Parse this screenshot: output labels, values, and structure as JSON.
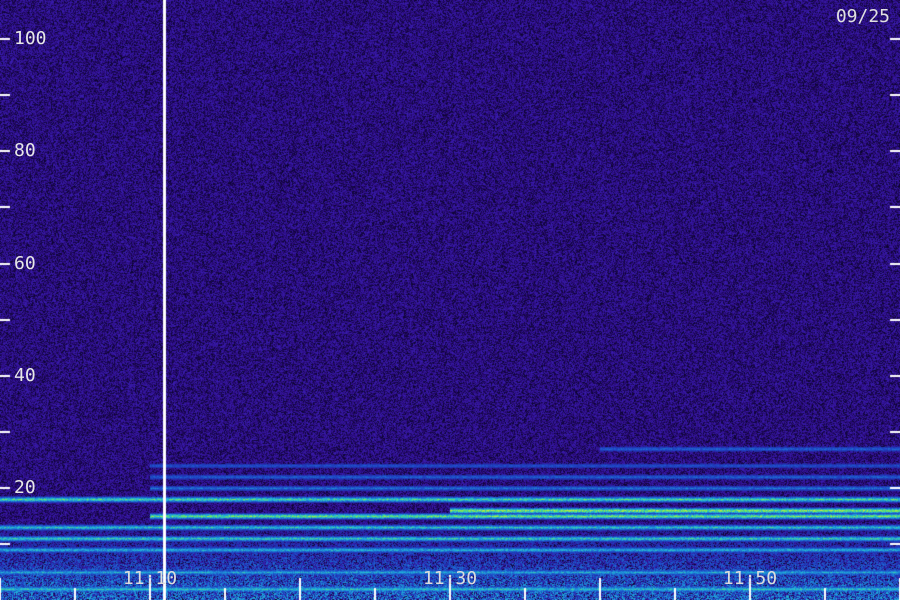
{
  "date_label": "09/25",
  "chart_data": {
    "type": "heatmap",
    "title": "",
    "xlabel": "",
    "ylabel": "",
    "y_ticks": [
      "100",
      "80",
      "60",
      "40",
      "20"
    ],
    "x_ticks": [
      "11:10",
      "11:30",
      "11:50"
    ],
    "ylim": [
      0,
      107
    ],
    "xlim": [
      "11:00",
      "12:00"
    ],
    "marker_time": "11:11",
    "colors": {
      "background": "#2a0a7a",
      "noise_dark": "#0a0428",
      "noise_bright": "#3a1eb4",
      "band_low": "#1e46c8",
      "band_mid": "#1eb4dc",
      "band_high": "#78f050",
      "band_peak": "#ffe63c",
      "marker": "#ffffff",
      "tick": "#ffffff"
    },
    "bands": [
      {
        "freq": 2,
        "start": "11:00",
        "end": "12:00",
        "level": 0.7
      },
      {
        "freq": 5,
        "start": "11:00",
        "end": "12:00",
        "level": 0.6
      },
      {
        "freq": 9,
        "start": "11:00",
        "end": "12:00",
        "level": 0.65
      },
      {
        "freq": 11,
        "start": "11:00",
        "end": "12:00",
        "level": 0.75
      },
      {
        "freq": 13,
        "start": "11:00",
        "end": "12:00",
        "level": 0.7
      },
      {
        "freq": 15,
        "start": "11:10",
        "end": "12:00",
        "level": 0.9
      },
      {
        "freq": 16,
        "start": "11:30",
        "end": "12:00",
        "level": 1.0
      },
      {
        "freq": 18,
        "start": "11:00",
        "end": "12:00",
        "level": 0.8
      },
      {
        "freq": 20,
        "start": "11:10",
        "end": "12:00",
        "level": 0.45
      },
      {
        "freq": 22,
        "start": "11:10",
        "end": "12:00",
        "level": 0.4
      },
      {
        "freq": 24,
        "start": "11:10",
        "end": "12:00",
        "level": 0.35
      },
      {
        "freq": 27,
        "start": "11:40",
        "end": "12:00",
        "level": 0.4
      }
    ]
  }
}
